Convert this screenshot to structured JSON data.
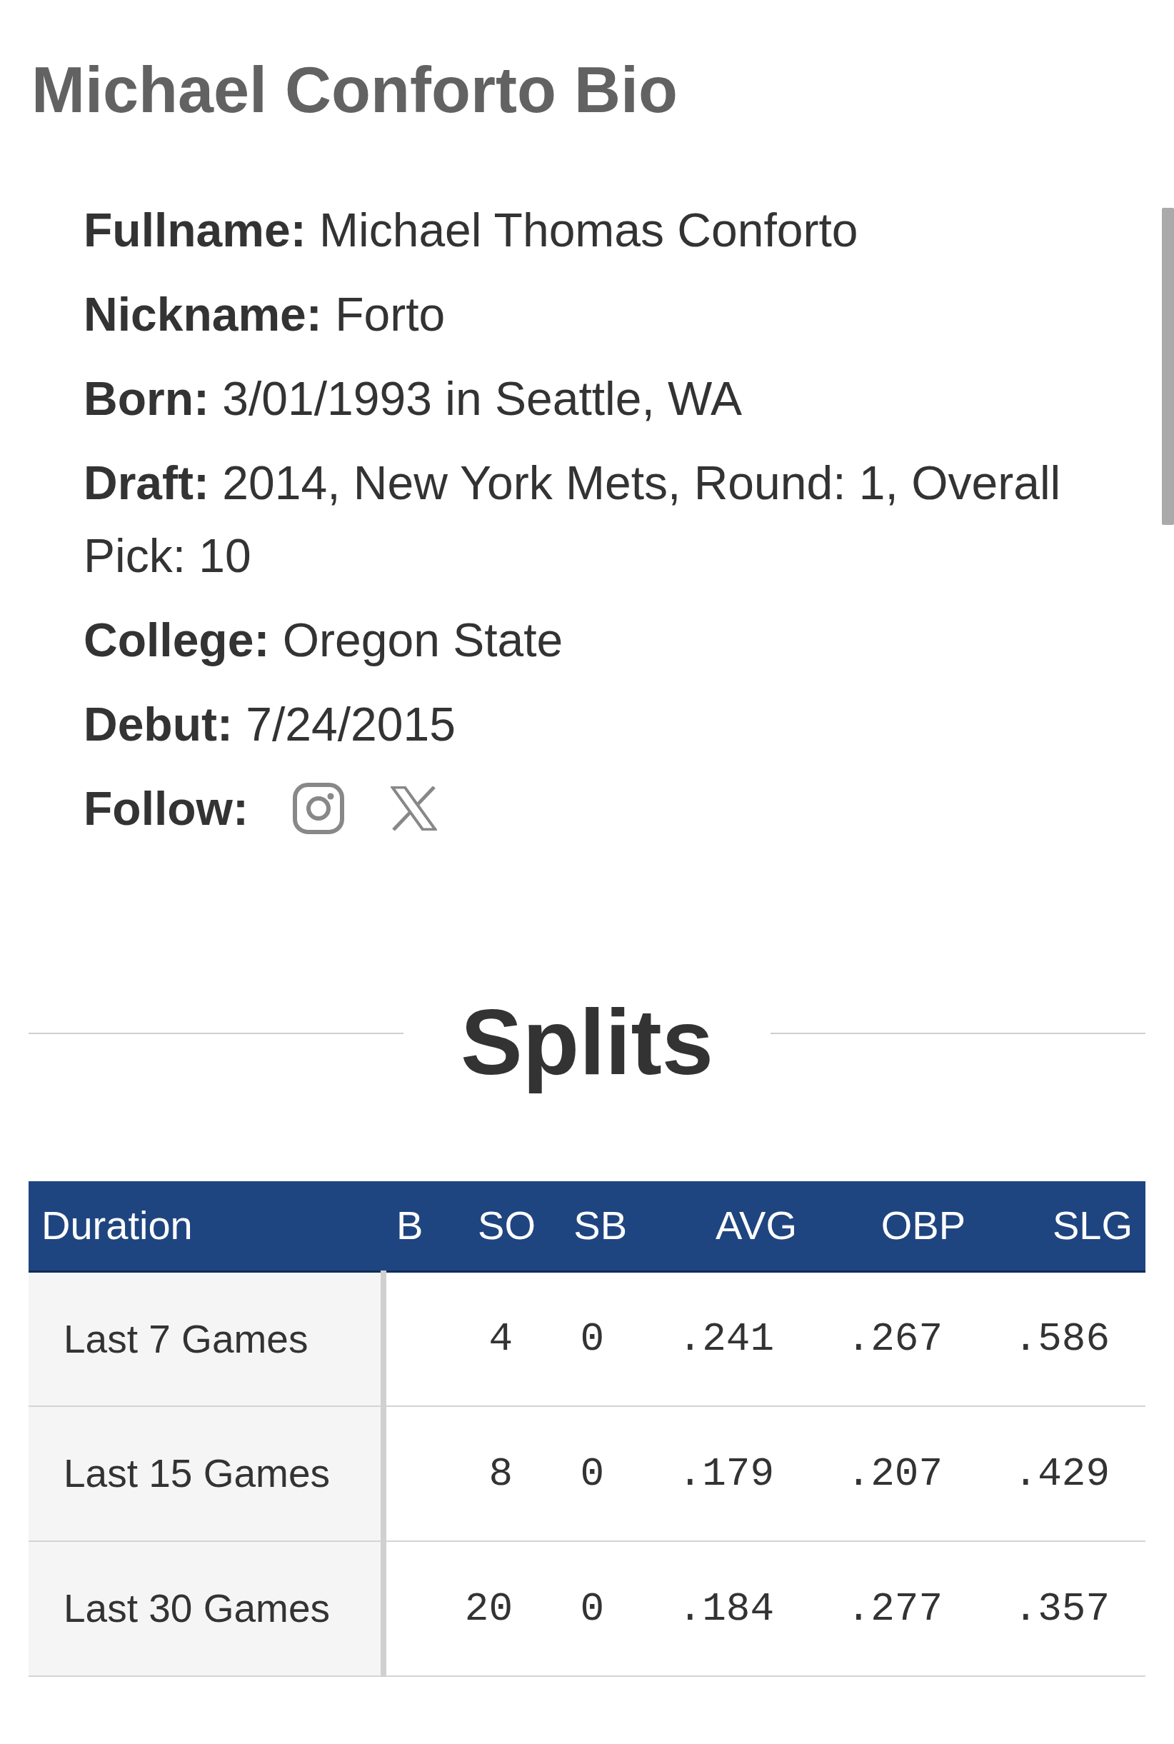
{
  "title": "Michael Conforto Bio",
  "bio": [
    "**Fullname:** Michael Thomas Conforto",
    "**Nickname:** Forto",
    "**Born:** 3/01/1993 in Seattle, WA",
    "**Draft:** 2014, New York Mets, Round: 1, Overall Pick: 10",
    "**College:** Oregon State",
    "**Debut:** 7/24/2015"
  ],
  "follow": {
    "label": "Follow:"
  },
  "splits": {
    "heading": "Splits",
    "table": {
      "columns": [
        {
          "label": "Duration",
          "kind": "label"
        },
        {
          "label": "B",
          "kind": "clipped"
        },
        {
          "label": "SO",
          "kind": "stat"
        },
        {
          "label": "SB",
          "kind": "stat"
        },
        {
          "label": "AVG",
          "kind": "stat"
        },
        {
          "label": "OBP",
          "kind": "stat"
        },
        {
          "label": "SLG",
          "kind": "stat"
        }
      ],
      "rows": [
        {
          "cells": [
            "Last 7 Games",
            "",
            "4",
            "0",
            ".241",
            ".267",
            ".586"
          ]
        },
        {
          "cells": [
            "Last 15 Games",
            "",
            "8",
            "0",
            ".179",
            ".207",
            ".429"
          ]
        },
        {
          "cells": [
            "Last 30 Games",
            "",
            "20",
            "0",
            ".184",
            ".277",
            ".357"
          ]
        }
      ]
    }
  }
}
